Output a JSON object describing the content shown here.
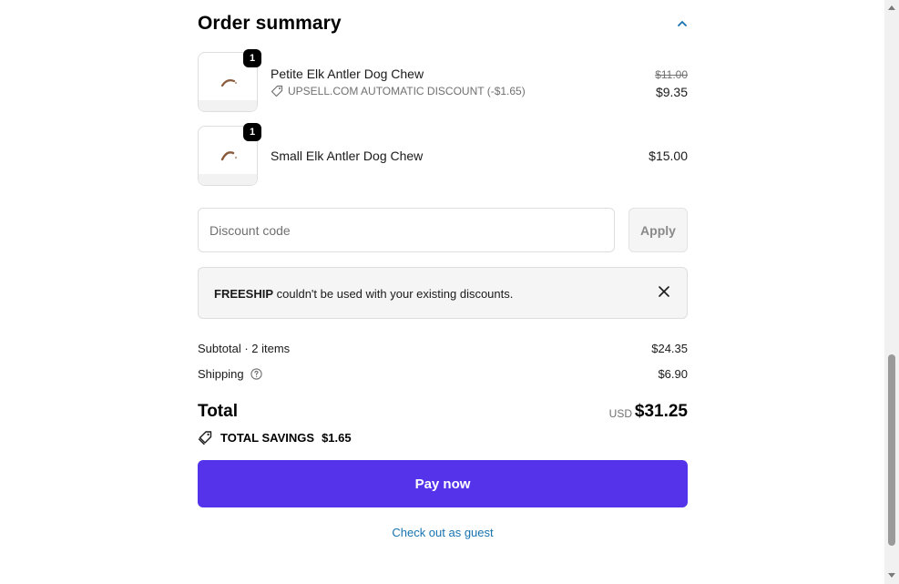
{
  "summary": {
    "title": "Order summary"
  },
  "items": [
    {
      "quantity": "1",
      "name": "Petite Elk Antler Dog Chew",
      "discount_label": "UPSELL.COM AUTOMATIC DISCOUNT (-$1.65)",
      "original_price": "$11.00",
      "price": "$9.35"
    },
    {
      "quantity": "1",
      "name": "Small Elk Antler Dog Chew",
      "price": "$15.00"
    }
  ],
  "discount": {
    "placeholder": "Discount code",
    "apply_label": "Apply"
  },
  "alert": {
    "code": "FREESHIP",
    "message": " couldn't be used with your existing discounts."
  },
  "totals": {
    "subtotal_label": "Subtotal · 2 items",
    "subtotal_value": "$24.35",
    "shipping_label": "Shipping",
    "shipping_value": "$6.90",
    "total_label": "Total",
    "currency": "USD",
    "total_value": "$31.25",
    "savings_label": "TOTAL SAVINGS",
    "savings_value": "$1.65"
  },
  "actions": {
    "pay_label": "Pay now",
    "guest_label": "Check out as guest"
  },
  "colors": {
    "pay_button": "#5433eb",
    "link": "#1773b0"
  }
}
